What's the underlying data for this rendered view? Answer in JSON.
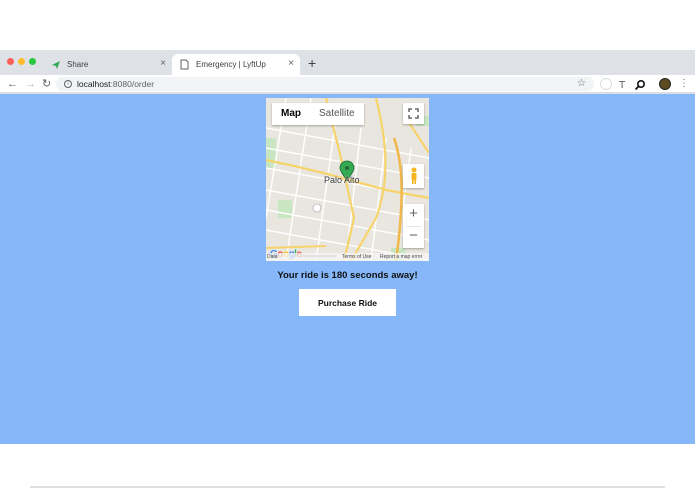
{
  "window": {
    "traffic_lights": [
      "#fc5f57",
      "#fdbc2e",
      "#28c840"
    ]
  },
  "tabs": [
    {
      "label": "Share",
      "icon": "send-icon",
      "active": false,
      "close": "×"
    },
    {
      "label": "Emergency | LyftUp",
      "icon": "document-icon",
      "active": true,
      "close": "×"
    }
  ],
  "new_tab": "+",
  "toolbar": {
    "back": "←",
    "forward": "→",
    "reload": "↻",
    "url_host": "localhost",
    "url_path": ":8080/order",
    "bookmark": "☆"
  },
  "map": {
    "type_map": "Map",
    "type_satellite": "Satellite",
    "city_label": "Palo Alto",
    "zoom_in": "+",
    "zoom_out": "−",
    "fullscreen": "⛶",
    "footer_data": "Data",
    "footer_terms": "Terms of Use",
    "footer_report": "Report a map error",
    "logo": "Google",
    "marker_color": "#34a853"
  },
  "page": {
    "background": "#86b8f9",
    "message": "Your ride is 180 seconds away!",
    "button_label": "Purchase Ride"
  }
}
